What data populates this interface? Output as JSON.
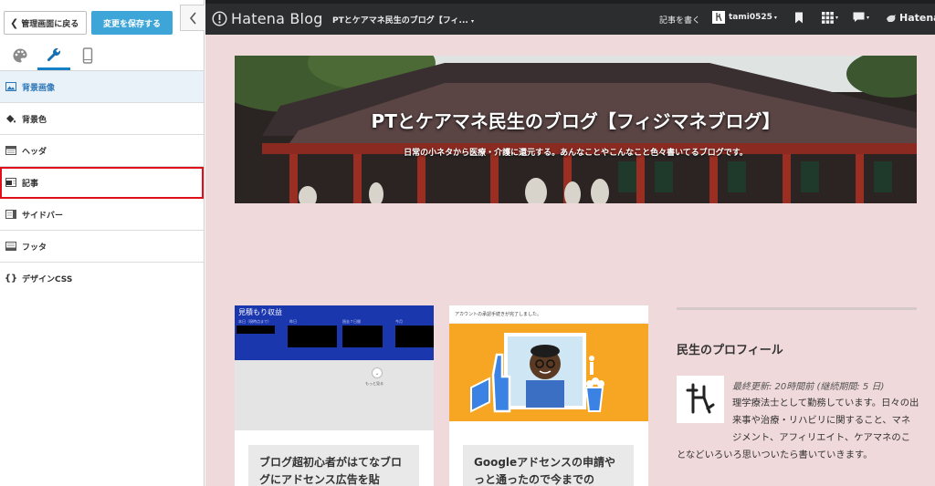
{
  "panel": {
    "back_label": "管理画面に戻る",
    "save_label": "変更を保存する",
    "menu": [
      {
        "label": "背景画像"
      },
      {
        "label": "背景色"
      },
      {
        "label": "ヘッダ"
      },
      {
        "label": "記事"
      },
      {
        "label": "サイドバー"
      },
      {
        "label": "フッタ"
      },
      {
        "label": "デザインCSS"
      }
    ]
  },
  "topbar": {
    "logo_text": "Hatena Blog",
    "blog_select": "PTとケアマネ民生のブログ【フィ...",
    "write_label": "記事を書く",
    "username": "tami0525",
    "brand": "Hatena"
  },
  "blog": {
    "title": "PTとケアマネ民生のブログ【フィジマネブログ】",
    "description": "日常の小ネタから医療・介護に還元する。あんなことやこんなこと色々書いてるブログです。"
  },
  "cards": [
    {
      "title": "ブログ超初心者がはてなブログにアドセンス広告を貼",
      "thumb_label": "見積もり収益",
      "thumb_cols": [
        "本日（現時点まで）",
        "昨日",
        "過去７日間",
        "今月"
      ],
      "thumb_more": "もっと見る"
    },
    {
      "title": "Googleアドセンスの申請やっと通ったので今までの",
      "thumb_notice": "アカウントの承認手続きが完了しました。"
    }
  ],
  "sidebar": {
    "heading": "民生のプロフィール",
    "updated": "最終更新: 20時間前 (継続期間: 5 日)",
    "bio": "理学療法士として勤務しています。日々の出来事や治療・リハビリに関すること、マネジメント、アフィリエイト、ケアマネのことなどいろいろ思いついたら書いていきます。"
  },
  "colors": {
    "preview_bg": "#f0d9da",
    "save_button": "#3ea5d8",
    "topbar": "#2c2d2f",
    "highlight": "#e0101a"
  }
}
